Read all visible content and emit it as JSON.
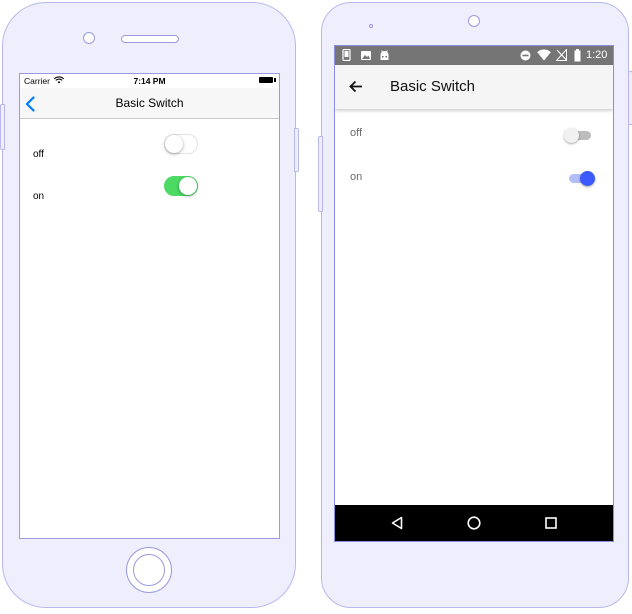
{
  "ios": {
    "status": {
      "carrier": "Carrier",
      "time": "7:14 PM"
    },
    "nav": {
      "title": "Basic Switch",
      "back_icon": "chevron-left-icon"
    },
    "rows": [
      {
        "label": "off",
        "checked": false
      },
      {
        "label": "on",
        "checked": true
      }
    ]
  },
  "android": {
    "status": {
      "time": "1:20"
    },
    "toolbar": {
      "title": "Basic Switch",
      "back_icon": "arrow-left-icon"
    },
    "rows": [
      {
        "label": "off",
        "checked": false
      },
      {
        "label": "on",
        "checked": true
      }
    ],
    "nav_icons": [
      "back-triangle-icon",
      "home-circle-icon",
      "recents-square-icon"
    ]
  },
  "colors": {
    "ios_switch_on": "#4cd964",
    "ios_tint": "#007aff",
    "android_accent": "#3d5afe",
    "frame_fill": "#eeeefc",
    "frame_stroke": "#b8b8ee"
  }
}
